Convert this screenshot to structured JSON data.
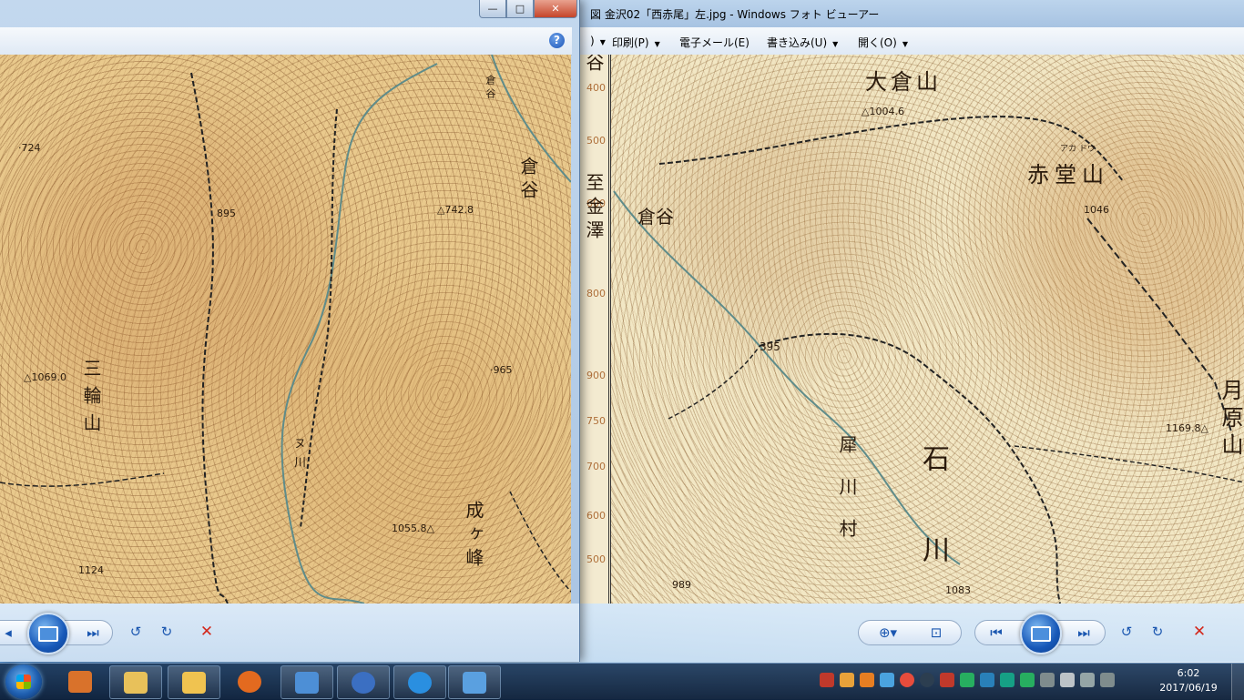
{
  "right_window": {
    "title": "図 金沢02「西赤尾」左.jpg - Windows フォト ビューアー",
    "menu": [
      {
        "label": ")",
        "has_dropdown": true
      },
      {
        "label": "印刷(P)",
        "has_dropdown": true
      },
      {
        "label": "電子メール(E)",
        "has_dropdown": false
      },
      {
        "label": "書き込み(U)",
        "has_dropdown": true
      },
      {
        "label": "開く(O)",
        "has_dropdown": true
      }
    ],
    "map": {
      "ruler_ticks": [
        "400",
        "500",
        "600",
        "700",
        "800",
        "900",
        "750",
        "700",
        "600",
        "500"
      ],
      "labels": {
        "ohkura_yama": "大倉山",
        "peak_1004": "△1004.6",
        "akadou_yama": "赤堂山",
        "akadou_kana": "アカ ドウ",
        "peak_1046": "1046",
        "kuradani": "倉谷",
        "to_kanazawa": "至金澤",
        "point_395": "395",
        "tsukihara_yama": "月原山",
        "peak_1169": "1169.8△",
        "saigawa": "犀川村",
        "ishikawa": "石川",
        "point_1083": "1083",
        "point_989": "989",
        "tani": "谷"
      }
    },
    "toolbar": {
      "zoom_icon": "zoom-icon",
      "actual_size_icon": "fit-icon",
      "prev_icon": "previous-icon",
      "slideshow_icon": "slideshow-icon",
      "next_icon": "next-icon",
      "rotate_left_icon": "rotate-ccw-icon",
      "rotate_right_icon": "rotate-cw-icon",
      "delete_icon": "delete-icon"
    }
  },
  "left_window": {
    "caption": {
      "minimize": "—",
      "maximize": "□",
      "close": "✕"
    },
    "help": "?",
    "map": {
      "labels": {
        "point_724": "·724",
        "point_895": "895",
        "peak_742": "△742.8",
        "kuradani_top": "倉谷",
        "kuradani": "倉谷",
        "peak_1069": "△1069.0",
        "miwa_yama": "三輪山",
        "nukawa": "ヌ川",
        "point_965": "·965",
        "narugamine": "成ヶ峰",
        "peak_1055": "1055.8△",
        "point_1124": "1124"
      }
    },
    "toolbar": {
      "prev_icon": "previous-icon",
      "slideshow_icon": "slideshow-icon",
      "next_icon": "next-icon",
      "rotate_left_icon": "rotate-ccw-icon",
      "rotate_right_icon": "rotate-cw-icon",
      "delete_icon": "delete-icon"
    }
  },
  "taskbar": {
    "apps": [
      {
        "name": "tools-app",
        "color": "#d9722b"
      },
      {
        "name": "explorer",
        "color": "#e8c15a"
      },
      {
        "name": "mail-app",
        "color": "#f0c350"
      },
      {
        "name": "firefox",
        "color": "#e36a1f"
      },
      {
        "name": "control-panel",
        "color": "#4d8fd6"
      },
      {
        "name": "media-player",
        "color": "#3b6fc2"
      },
      {
        "name": "internet-explorer",
        "color": "#2a8fe0"
      },
      {
        "name": "photo-viewer",
        "color": "#5aa0e0"
      }
    ],
    "tray": [
      "#c0392b",
      "#e8a23a",
      "#e67e22",
      "#4aa3df",
      "#e74c3c",
      "#2c3e50",
      "#c0392b",
      "#27ae60",
      "#2980b9",
      "#16a085",
      "#27ae60",
      "#7f8c8d",
      "#bdc3c7",
      "#95a5a6",
      "#7f8c8d"
    ],
    "clock": {
      "time": "6:02",
      "date": "2017/06/19"
    }
  }
}
